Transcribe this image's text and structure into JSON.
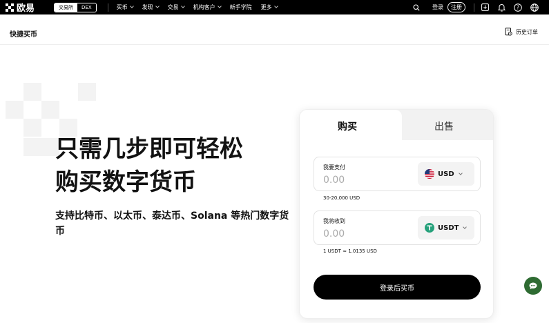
{
  "nav": {
    "brand": "欧易",
    "segment": [
      "交易所",
      "DEX"
    ],
    "menu": [
      {
        "label": "买币",
        "has_dropdown": true
      },
      {
        "label": "发现",
        "has_dropdown": true
      },
      {
        "label": "交易",
        "has_dropdown": true
      },
      {
        "label": "机构客户",
        "has_dropdown": true
      },
      {
        "label": "新手学院",
        "has_dropdown": false
      },
      {
        "label": "更多",
        "has_dropdown": true
      }
    ],
    "login": "登录",
    "register": "注册"
  },
  "subheader": {
    "title": "快捷买币",
    "history": "历史订单"
  },
  "hero": {
    "line1": "只需几步即可轻松",
    "line2": "购买数字货币",
    "subtitle": "支持比特币、以太币、泰达币、Solana 等热门数字货币"
  },
  "card": {
    "tabs": {
      "buy": "购买",
      "sell": "出售"
    },
    "pay": {
      "label": "我要支付",
      "value": "0.00",
      "currency": "USD",
      "range": "30-20,000 USD"
    },
    "receive": {
      "label": "我将收到",
      "value": "0.00",
      "currency": "USDT",
      "rate": "1 USDT ≈ 1.0135 USD"
    },
    "cta": "登录后买币"
  },
  "colors": {
    "accent": "#000000",
    "tether": "#26a17b",
    "chat": "#2e6b32"
  }
}
